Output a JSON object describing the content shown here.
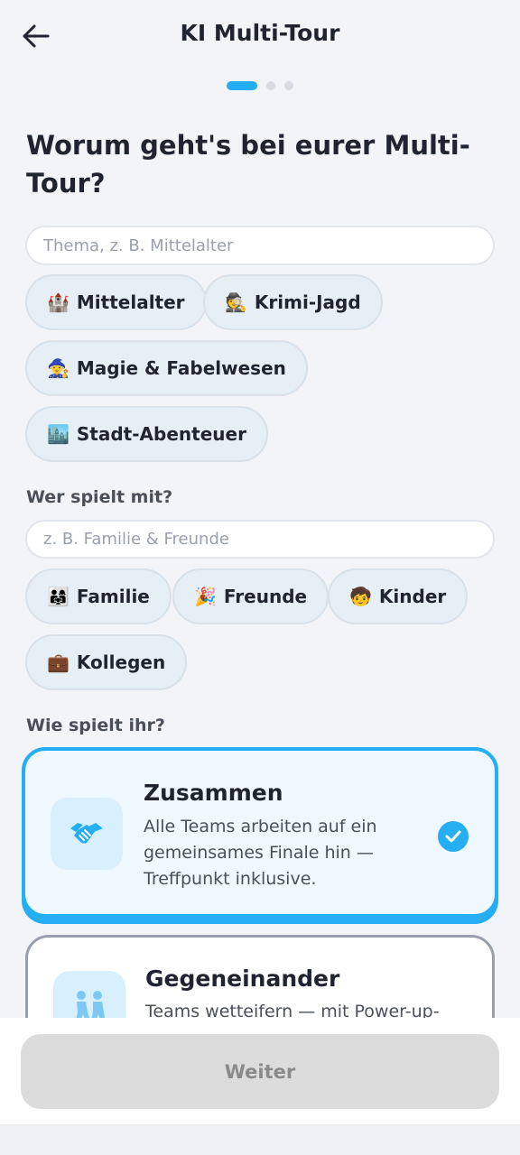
{
  "header": {
    "title": "KI Multi-Tour",
    "back_icon": "arrow-left-icon"
  },
  "progress": {
    "current_step": 1,
    "total_steps": 3
  },
  "question": "Worum geht's bei eurer Multi-Tour?",
  "topic": {
    "placeholder": "Thema, z. B. Mittelalter",
    "value": "",
    "chips": [
      {
        "emoji": "🏰",
        "label": "Mittelalter"
      },
      {
        "emoji": "🕵️",
        "label": "Krimi-Jagd"
      },
      {
        "emoji": "🧙",
        "label": "Magie & Fabelwesen"
      },
      {
        "emoji": "🏙️",
        "label": "Stadt-Abenteuer"
      }
    ]
  },
  "players": {
    "label": "Wer spielt mit?",
    "placeholder": "z. B. Familie & Freunde",
    "value": "",
    "chips": [
      {
        "emoji": "👨‍👩‍👧",
        "label": "Familie"
      },
      {
        "emoji": "🎉",
        "label": "Freunde"
      },
      {
        "emoji": "🧒",
        "label": "Kinder"
      },
      {
        "emoji": "💼",
        "label": "Kollegen"
      }
    ]
  },
  "mode": {
    "label": "Wie spielt ihr?",
    "options": [
      {
        "title": "Zusammen",
        "description": "Alle Teams arbeiten auf ein gemeinsames Finale hin — Treffpunkt inklusive.",
        "icon": "handshake-icon",
        "selected": true
      },
      {
        "title": "Gegeneinander",
        "description": "Teams wetteifern — mit Power-up-",
        "icon": "competition-icon",
        "selected": false
      }
    ]
  },
  "footer": {
    "next_label": "Weiter"
  },
  "colors": {
    "accent": "#25aef1",
    "background": "#f2f4f8",
    "chip_bg": "#e6eef6",
    "disabled_button": "#dcdcdc"
  }
}
